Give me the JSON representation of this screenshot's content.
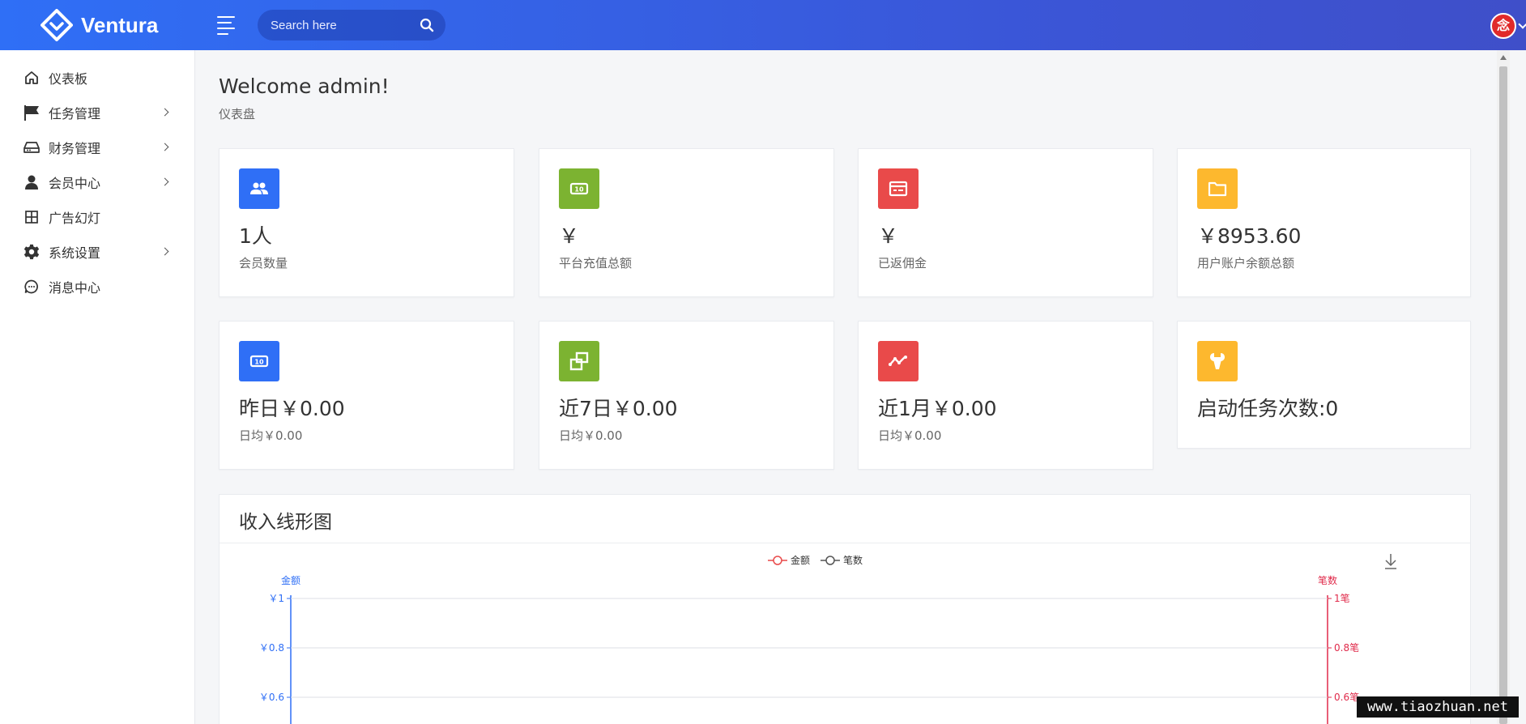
{
  "app": {
    "name": "Ventura"
  },
  "header": {
    "search_placeholder": "Search here",
    "avatar_text": "念"
  },
  "sidebar": {
    "items": [
      {
        "label": "仪表板",
        "icon": "home-icon",
        "has_arrow": false
      },
      {
        "label": "任务管理",
        "icon": "flag-icon",
        "has_arrow": true
      },
      {
        "label": "财务管理",
        "icon": "hard-drive-icon",
        "has_arrow": true
      },
      {
        "label": "会员中心",
        "icon": "user-icon",
        "has_arrow": true
      },
      {
        "label": "广告幻灯",
        "icon": "grid-icon",
        "has_arrow": false
      },
      {
        "label": "系统设置",
        "icon": "gear-icon",
        "has_arrow": true
      },
      {
        "label": "消息中心",
        "icon": "message-icon",
        "has_arrow": false
      }
    ]
  },
  "page": {
    "title": "Welcome admin!",
    "breadcrumb": "仪表盘"
  },
  "cards": [
    {
      "value": "1人",
      "label": "会员数量",
      "icon": "users-icon",
      "color": "#2f6ff6"
    },
    {
      "value": "￥",
      "label": "平台充值总额",
      "icon": "money-icon",
      "color": "#7cb331"
    },
    {
      "value": "￥",
      "label": "已返佣金",
      "icon": "credit-card-icon",
      "color": "#e94a4a"
    },
    {
      "value": "￥8953.60",
      "label": "用户账户余额总额",
      "icon": "folder-icon",
      "color": "#fdb82e"
    },
    {
      "value": "昨日￥0.00",
      "label": "日均￥0.00",
      "icon": "money-icon",
      "color": "#2f6ff6"
    },
    {
      "value": "近7日￥0.00",
      "label": "日均￥0.00",
      "icon": "copy-icon",
      "color": "#7cb331"
    },
    {
      "value": "近1月￥0.00",
      "label": "日均￥0.00",
      "icon": "activity-icon",
      "color": "#e94a4a"
    },
    {
      "value": "启动任务次数:0",
      "label": "",
      "icon": "wrench-icon",
      "color": "#fdb82e"
    }
  ],
  "chart_card": {
    "title": "收入线形图",
    "download_icon": "download-icon"
  },
  "chart_data": {
    "type": "line",
    "title": "",
    "series": [
      {
        "name": "金额",
        "color": "#e94a4a",
        "values": []
      },
      {
        "name": "笔数",
        "color": "#555555",
        "values": []
      }
    ],
    "y_left": {
      "label": "金额",
      "ticks": [
        "￥1",
        "￥0.8",
        "￥0.6"
      ],
      "color": "#2f6ff6"
    },
    "y_right": {
      "label": "笔数",
      "ticks": [
        "1笔",
        "0.8笔",
        "0.6笔"
      ],
      "color": "#e02a4a"
    },
    "ylim": [
      0,
      1
    ],
    "grid": true,
    "legend_position": "top-center"
  },
  "watermark": "www.tiaozhuan.net"
}
